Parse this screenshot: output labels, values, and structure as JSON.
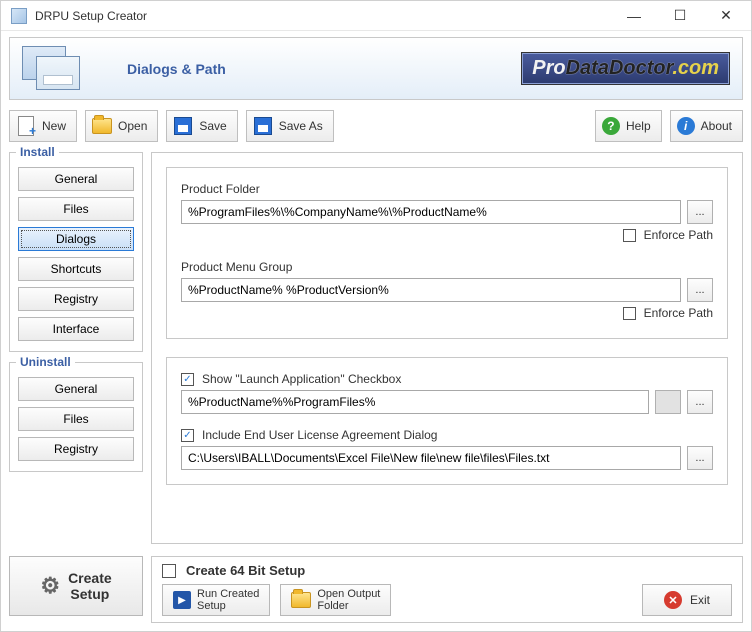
{
  "window": {
    "title": "DRPU Setup Creator"
  },
  "header": {
    "title": "Dialogs & Path",
    "brand_pro": "Pro",
    "brand_mid": "DataDoctor",
    "brand_com": ".com"
  },
  "toolbar": {
    "new": "New",
    "open": "Open",
    "save": "Save",
    "saveas": "Save As",
    "help": "Help",
    "about": "About"
  },
  "sidebar": {
    "install_label": "Install",
    "install": [
      "General",
      "Files",
      "Dialogs",
      "Shortcuts",
      "Registry",
      "Interface"
    ],
    "uninstall_label": "Uninstall",
    "uninstall": [
      "General",
      "Files",
      "Registry"
    ]
  },
  "panel": {
    "product_folder_label": "Product Folder",
    "product_folder_value": "%ProgramFiles%\\%CompanyName%\\%ProductName%",
    "product_menu_label": "Product Menu Group",
    "product_menu_value": "%ProductName% %ProductVersion%",
    "enforce_path": "Enforce Path",
    "show_launch_label": "Show \"Launch Application\" Checkbox",
    "launch_value": "%ProductName%%ProgramFiles%",
    "include_eula_label": "Include End User License Agreement Dialog",
    "eula_value": "C:\\Users\\IBALL\\Documents\\Excel File\\New file\\new file\\files\\Files.txt",
    "browse": "..."
  },
  "footer": {
    "create": "Create\nSetup",
    "create64": "Create 64 Bit Setup",
    "run": "Run Created\nSetup",
    "openout": "Open Output\nFolder",
    "exit": "Exit"
  }
}
